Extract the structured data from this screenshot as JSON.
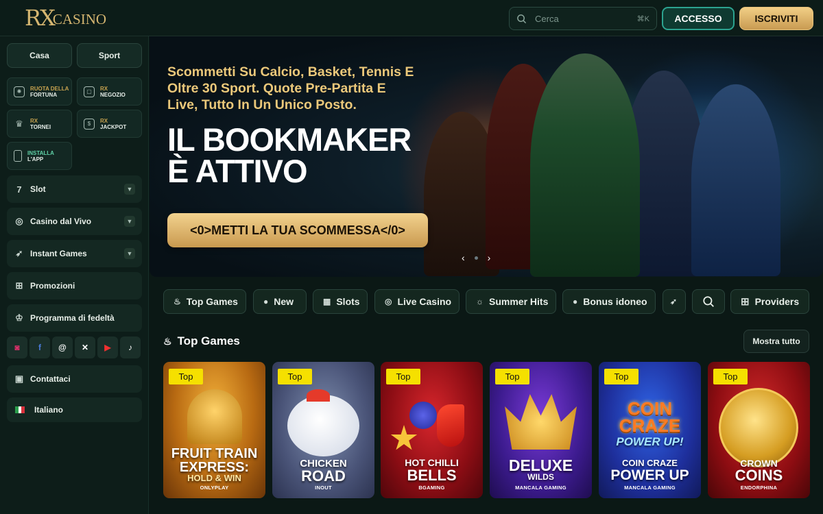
{
  "header": {
    "logo_mark": "RX",
    "logo_word": "CASINO",
    "search_placeholder": "Cerca",
    "search_shortcut": "⌘K",
    "login_label": "ACCESSO",
    "signup_label": "ISCRIVITI"
  },
  "sidebar": {
    "toggles": [
      "Casa",
      "Sport"
    ],
    "tiles": [
      {
        "line1": "RUOTA DELLA",
        "line2": "FORTUNA",
        "icon": "wheel-icon"
      },
      {
        "line1": "RX",
        "line2": "NEGOZIO",
        "icon": "shop-bag-icon"
      },
      {
        "line1": "RX",
        "line2": "TORNEI",
        "icon": "trophy-icon"
      },
      {
        "line1": "RX",
        "line2": "JACKPOT",
        "icon": "jackpot-icon"
      },
      {
        "line1": "INSTALLA",
        "line2": "L'APP",
        "icon": "phone-icon"
      }
    ],
    "nav": [
      {
        "label": "Slot",
        "icon": "seven-icon",
        "expandable": true
      },
      {
        "label": "Casino dal Vivo",
        "icon": "chip-icon",
        "expandable": true
      },
      {
        "label": "Instant Games",
        "icon": "rocket-icon",
        "expandable": true
      },
      {
        "label": "Promozioni",
        "icon": "gift-icon",
        "expandable": false
      },
      {
        "label": "Programma di fedeltà",
        "icon": "crown-icon",
        "expandable": false
      }
    ],
    "socials": [
      "instagram-icon",
      "facebook-icon",
      "threads-icon",
      "x-icon",
      "youtube-icon",
      "tiktok-icon"
    ],
    "contact_label": "Contattaci",
    "language_label": "Italiano"
  },
  "hero": {
    "subtitle": "Scommetti Su Calcio, Basket, Tennis E Oltre 30 Sport. Quote Pre-Partita E Live, Tutto In Un Unico Posto.",
    "title_line1": "IL BOOKMAKER",
    "title_line2": "È ATTIVO",
    "cta_label": "<0>METTI LA TUA SCOMMESSA</0>"
  },
  "categories": [
    "Top Games",
    "New",
    "Slots",
    "Live Casino",
    "Summer Hits",
    "Bonus idoneo"
  ],
  "providers_label": "Providers",
  "section": {
    "title": "Top Games",
    "show_all": "Mostra tutto"
  },
  "games": [
    {
      "badge": "Top",
      "name1": "FRUIT TRAIN",
      "name2": "EXPRESS:",
      "name3": "HOLD & WIN",
      "provider": "ONLYPLAY"
    },
    {
      "badge": "Top",
      "name1": "CHICKEN",
      "name2": "ROAD",
      "name3": "",
      "provider": "INOUT"
    },
    {
      "badge": "Top",
      "name1": "HOT CHILLI",
      "name2": "BELLS",
      "name3": "",
      "provider": "BGAMING"
    },
    {
      "badge": "Top",
      "name1": "DELUXE",
      "name2": "WILDS",
      "name3": "",
      "provider": "MANCALA GAMING"
    },
    {
      "badge": "Top",
      "name1": "COIN CRAZE",
      "name2": "POWER UP",
      "name3": "",
      "provider": "MANCALA GAMING"
    },
    {
      "badge": "Top",
      "name1": "CROWN",
      "name2": "COINS",
      "name3": "",
      "provider": "ENDORPHINA"
    }
  ]
}
